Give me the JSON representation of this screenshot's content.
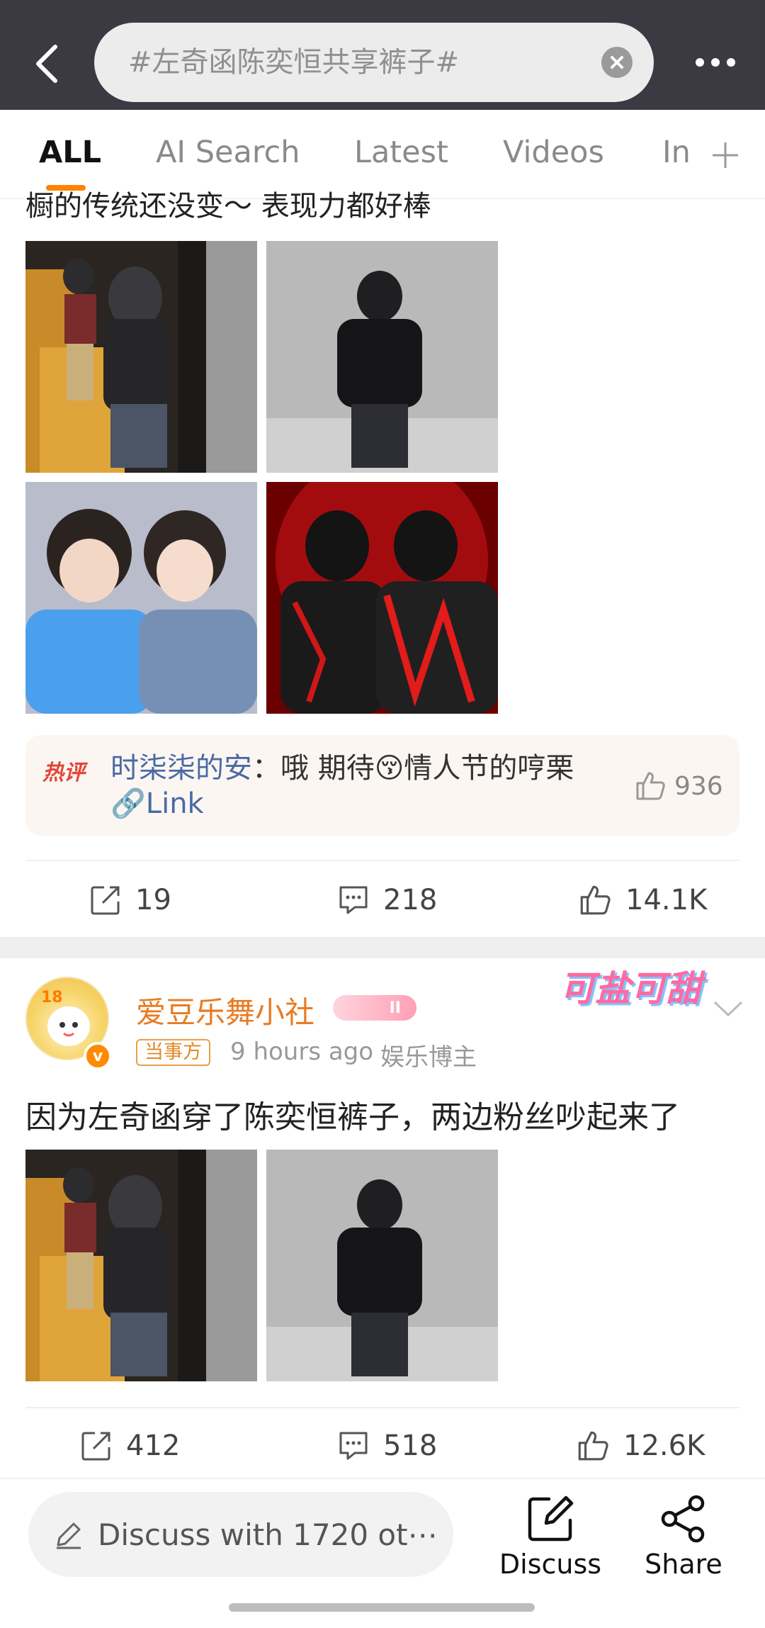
{
  "header": {
    "search_text": "#左奇函陈奕恒共享裤子#"
  },
  "tabs": [
    {
      "label": "ALL"
    },
    {
      "label": "AI Search"
    },
    {
      "label": "Latest"
    },
    {
      "label": "Videos"
    },
    {
      "label": "In"
    }
  ],
  "post1": {
    "text_cut": "橱的传统还没变～ 表现力都好棒",
    "hot_comment": {
      "badge": "热评",
      "user": "时柒柒的安",
      "separator": "：",
      "text": "哦 期待😚情人节的哼栗 ",
      "link": "🔗Link",
      "likes": "936"
    },
    "actions": {
      "repost": "19",
      "comments": "218",
      "likes": "14.1K"
    }
  },
  "post2": {
    "author": "爱豆乐舞小社",
    "level": "II",
    "role_tag": "当事方",
    "time": "9 hours ago",
    "author_role": "娱乐博主",
    "sticker": "可盐可甜",
    "text": "因为左奇函穿了陈奕恒裤子，两边粉丝吵起来了",
    "actions": {
      "repost": "412",
      "comments": "518",
      "likes": "12.6K"
    }
  },
  "bottom": {
    "discuss_placeholder": "Discuss with 1720 ot⋯",
    "discuss_label": "Discuss",
    "share_label": "Share"
  }
}
